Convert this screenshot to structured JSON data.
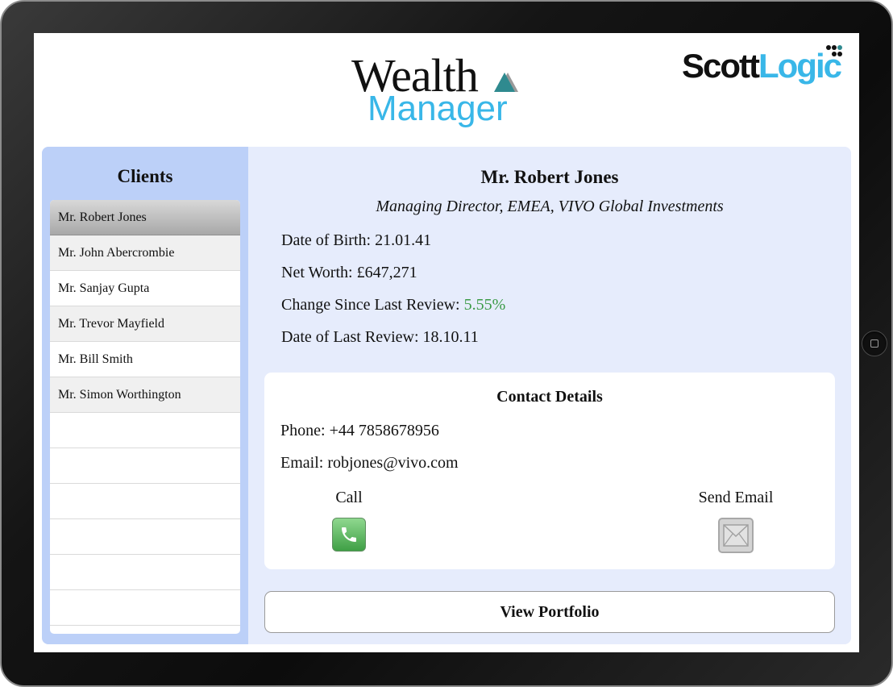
{
  "app": {
    "logo_wealth": "Wealth",
    "logo_manager": "Manager",
    "brand_scott": "Scott",
    "brand_logic": "Logic"
  },
  "sidebar": {
    "title": "Clients",
    "clients": [
      "Mr. Robert Jones",
      "Mr. John Abercrombie",
      "Mr. Sanjay Gupta",
      "Mr. Trevor Mayfield",
      "Mr. Bill Smith",
      "Mr. Simon Worthington"
    ],
    "selected_index": 0
  },
  "client": {
    "name": "Mr. Robert Jones",
    "role": "Managing Director, EMEA, VIVO Global Investments",
    "dob_label": "Date of Birth:",
    "dob": "21.01.41",
    "net_worth_label": "Net Worth:",
    "net_worth": "£647,271",
    "change_label": "Change Since Last Review:",
    "change": "5.55%",
    "last_review_label": "Date of Last Review:",
    "last_review": "18.10.11"
  },
  "contact": {
    "title": "Contact Details",
    "phone_label": "Phone:",
    "phone": "+44 7858678956",
    "email_label": "Email:",
    "email": "robjones@vivo.com",
    "call_label": "Call",
    "send_email_label": "Send Email"
  },
  "actions": {
    "view_portfolio": "View Portfolio"
  },
  "colors": {
    "accent_blue": "#39b7e8",
    "positive_green": "#3a9a46",
    "sidebar_bg": "#bcd0f8",
    "panel_bg": "#e6ecfc"
  }
}
